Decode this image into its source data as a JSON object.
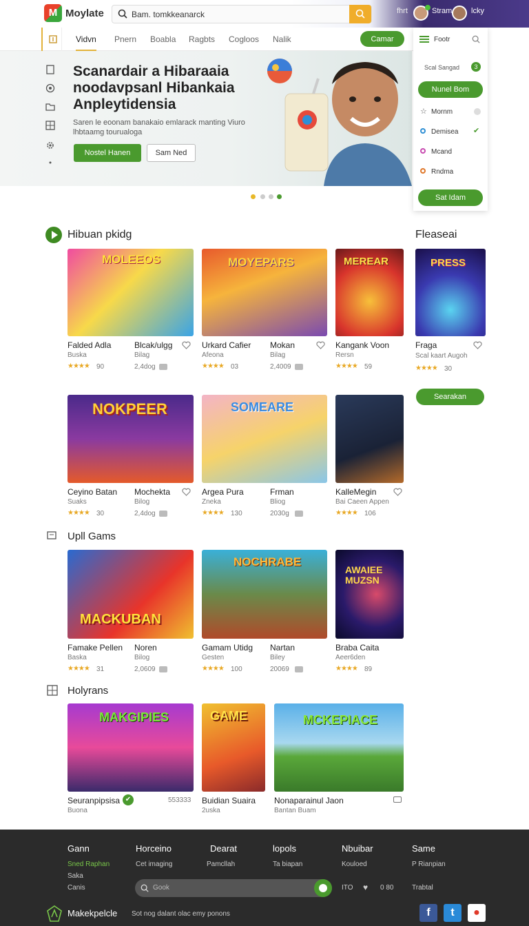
{
  "header": {
    "logo_text": "Moylate",
    "search_value": "Bam. tomkkeanarck",
    "right_label": "fhrt",
    "user1": "Stram",
    "user2": "lcky"
  },
  "nav": {
    "items": [
      "Vidvn",
      "Pnern",
      "Boabla",
      "Ragbts",
      "Cogloos",
      "Nalik"
    ],
    "cta": "Camar"
  },
  "panel": {
    "title": "Footr",
    "status": "Scal Sangad",
    "status_count": "3",
    "primary": "Nunel Bom",
    "items": [
      "Mornm",
      "Demisea",
      "Mcand",
      "Rndma"
    ],
    "secondary": "Sat Idam"
  },
  "hero": {
    "title": "Scanardair a Hibaraaia noodavpsanl Hibankaia Anpleytidensia",
    "subtitle": "Saren le eoonam banakaio emlarack manting Viuro lhbtaamg tourualoga",
    "primary": "Nostel Hanen",
    "secondary": "Sam Ned"
  },
  "sections": {
    "s1": "Hibuan pkidg",
    "s2": "Upll Gams",
    "s3": "Holyrans",
    "side": "Fleaseai",
    "side_button": "Searakan"
  },
  "row1": [
    {
      "title": "Falded Adla",
      "sub": "Buska",
      "rating": "90",
      "title2": "Blcak/ulgg",
      "sub2": "Bilag",
      "reviews": "2,4dog"
    },
    {
      "title": "Urkard Cafier",
      "sub": "Afeona",
      "rating": "03",
      "title2": "Mokan",
      "sub2": "Bilag",
      "reviews": "2,4009"
    },
    {
      "title": "Kangank Voon",
      "sub": "Rersn",
      "rating": "59"
    }
  ],
  "side_card": {
    "title": "Fraga",
    "sub": "Scal kaart Augoh",
    "rating": "30"
  },
  "row2": [
    {
      "title": "Ceyino Batan",
      "sub": "Suaks",
      "rating": "30",
      "title2": "Mochekta",
      "sub2": "Bilog",
      "reviews": "2,4dog"
    },
    {
      "title": "Argea Pura",
      "sub": "Zneka",
      "rating": "130",
      "title2": "Frman",
      "sub2": "Bliog",
      "reviews": "2030g"
    },
    {
      "title": "KalleMegin",
      "sub": "Bai Caeen Appen",
      "rating": "106"
    }
  ],
  "row3": [
    {
      "title": "Famake Pellen",
      "sub": "Baska",
      "rating": "31",
      "title2": "Noren",
      "sub2": "Bilog",
      "reviews": "2,0609"
    },
    {
      "title": "Gamam Utidg",
      "sub": "Gesten",
      "rating": "100",
      "title2": "Nartan",
      "sub2": "Biley",
      "reviews": "20069"
    },
    {
      "title": "Braba Caita",
      "sub": "Aeer6den",
      "rating": "89"
    }
  ],
  "row4": [
    {
      "title": "Seuranpipsisa",
      "sub": "Buona",
      "extra": "553333"
    },
    {
      "title": "Buidian Suaira",
      "sub": "2uska"
    },
    {
      "title": "Nonaparainul Jaon",
      "sub": "Bantan Buam"
    }
  ],
  "art_text": [
    "MOLEEOS",
    "MOYEPARS",
    "MEREAR",
    "PRESS",
    "NOKPEER",
    "SOMEARE",
    "MACKUBAN",
    "NOCHRABE",
    "AWAIEE MUZSN",
    "MAKGIPIES",
    "GAME",
    "MCKEPIACE"
  ],
  "footer": {
    "cols": [
      {
        "head": "Gann",
        "links": [
          "Sned Raphan",
          "Saka",
          "Canis"
        ]
      },
      {
        "head": "Horceino",
        "links": [
          "Cet imaging"
        ]
      },
      {
        "head": "Dearat",
        "links": [
          "Pamcllah"
        ]
      },
      {
        "head": "lopols",
        "links": [
          "Ta biapan"
        ]
      },
      {
        "head": "Nbuibar",
        "links": [
          "Kouloed"
        ]
      },
      {
        "head": "Same",
        "links": [
          "P Rianpian",
          "Trabtal"
        ]
      }
    ],
    "search_placeholder": "Gook",
    "nums": [
      "ITO",
      "0 80"
    ],
    "brand": "Makekpelcle",
    "tagline": "Sot nog dalant olac emy ponons"
  },
  "colors": {
    "green": "#4a9a2e",
    "gold": "#f0ad2a",
    "footer": "#2b2b2b",
    "star": "#e8a824"
  }
}
